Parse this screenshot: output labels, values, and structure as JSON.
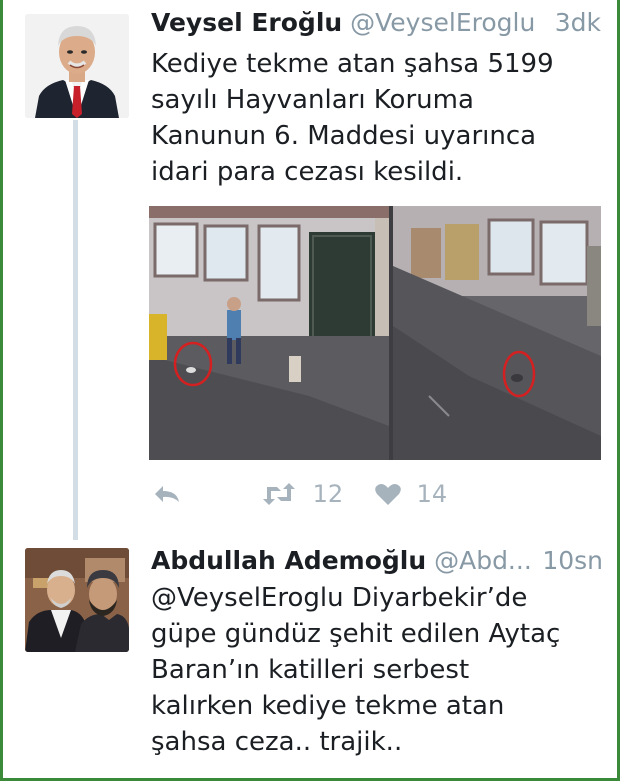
{
  "tweets": [
    {
      "name": "Veysel Eroğlu",
      "handle": "@VeyselEroglu",
      "time": "3dk",
      "text": "Kediye tekme atan şahsa 5199\nsayılı Hayvanları Koruma\nKanunun 6. Maddesi uyarınca\nidari para cezası kesildi.",
      "retweets": "12",
      "likes": "14"
    },
    {
      "name": "Abdullah Ademoğlu",
      "handle": "@Abd...",
      "time": "10sn",
      "text": "@VeyselEroglu Diyarbekir’de\ngüpe gündüz şehit edilen Aytaç\nBaran’ın katilleri serbest\nkalırken kediye tekme atan\nşahsa ceza.. trajik.."
    }
  ],
  "colors": {
    "text": "#1b1f23",
    "secondary_text": "#8899a6",
    "action_icons": "#a6b3bd",
    "thread_line": "#d3dde5",
    "frame_border": "#3a8a3a",
    "highlight_circle": "#d42020"
  },
  "icons": {
    "reply": "reply-icon",
    "retweet": "retweet-icon",
    "like": "heart-icon"
  }
}
